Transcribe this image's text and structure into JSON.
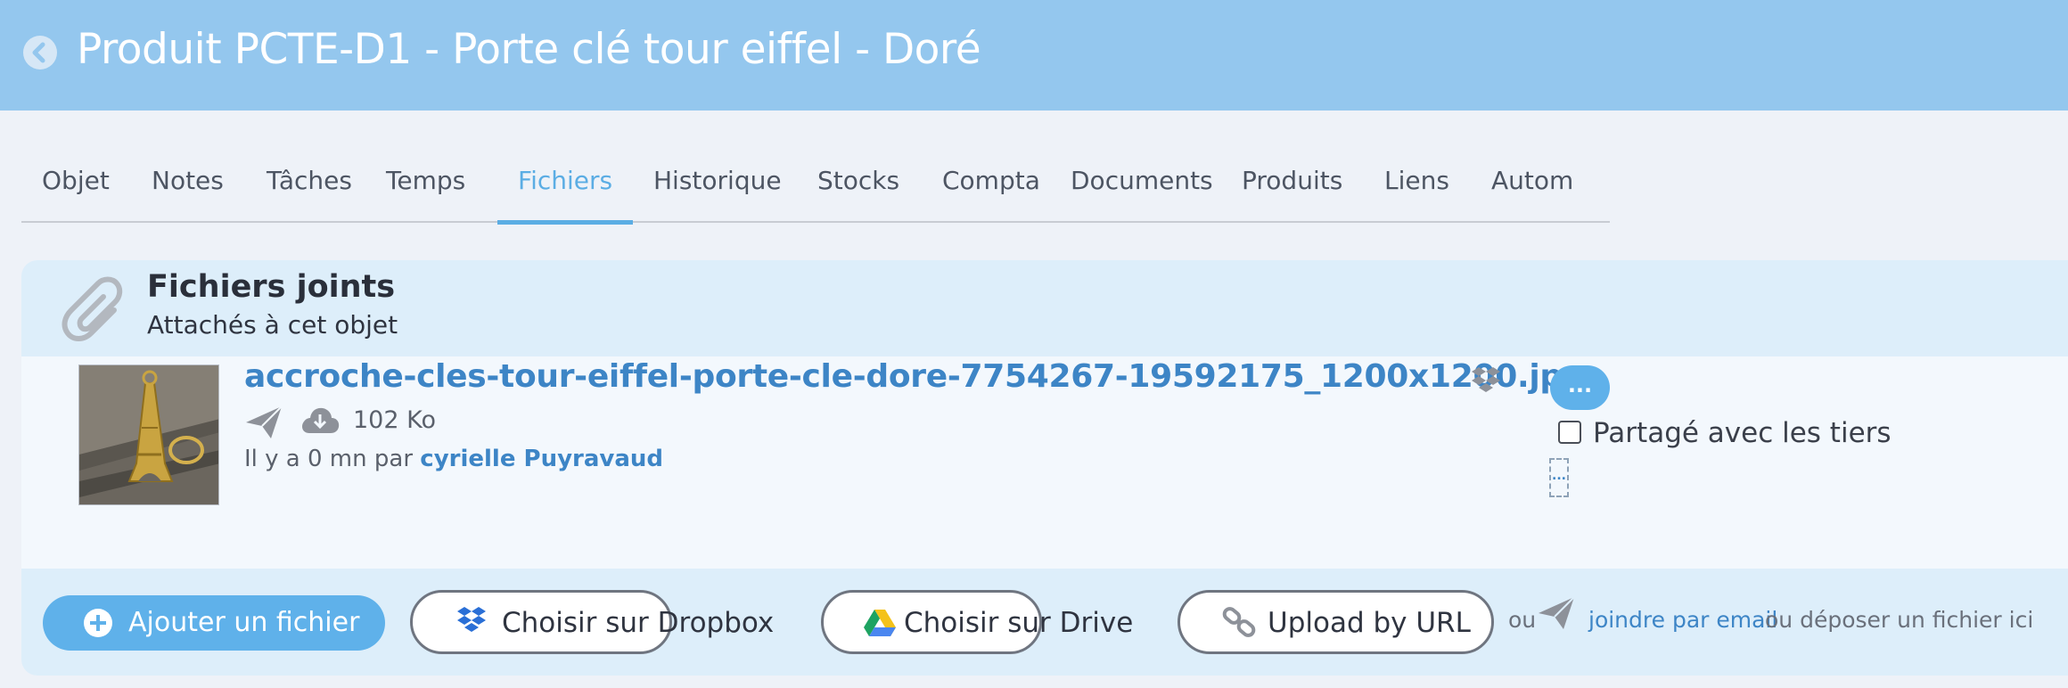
{
  "header": {
    "title": "Produit PCTE-D1 - Porte clé tour eiffel - Doré",
    "back_icon": "chevron-left-circle-icon"
  },
  "tabs": [
    {
      "label": "Objet"
    },
    {
      "label": "Notes"
    },
    {
      "label": "Tâches"
    },
    {
      "label": "Temps"
    },
    {
      "label": "Fichiers",
      "active": true
    },
    {
      "label": "Historique"
    },
    {
      "label": "Stocks"
    },
    {
      "label": "Compta"
    },
    {
      "label": "Documents"
    },
    {
      "label": "Produits"
    },
    {
      "label": "Liens"
    },
    {
      "label": "Autom"
    }
  ],
  "panel": {
    "title": "Fichiers joints",
    "subtitle": "Attachés à cet objet",
    "icon": "paperclip-icon"
  },
  "file": {
    "name": "accroche-cles-tour-eiffel-porte-cle-dore-7754267-19592175_1200x1200.jpg",
    "size": "102 Ko",
    "meta_prefix": "Il y a 0 mn par ",
    "author": "cyrielle Puyravaud",
    "more_label": "...",
    "share_label": "Partagé avec les tiers",
    "shared": false,
    "dotted_label": "..."
  },
  "actions": {
    "add_file": "Ajouter un fichier",
    "dropbox": "Choisir sur Dropbox",
    "drive": "Choisir sur Drive",
    "url": "Upload by URL",
    "ou": "ou",
    "email_link": "joindre par email",
    "drop_text": "ou déposer un fichier ici"
  },
  "colors": {
    "header_bg": "#94c7ee",
    "accent": "#5fb1ea",
    "link": "#3d85c6",
    "panel_bg": "#ddeefa"
  }
}
